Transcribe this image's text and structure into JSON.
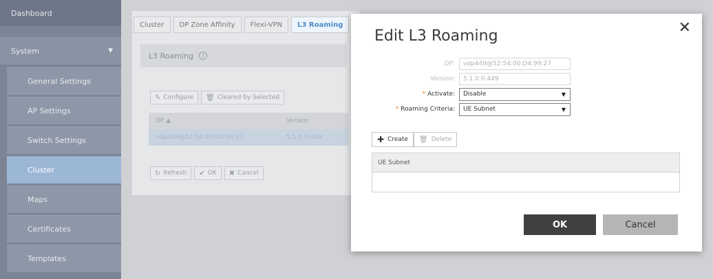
{
  "sidebar": {
    "dashboard": "Dashboard",
    "system": "System",
    "items": [
      {
        "label": "General Settings"
      },
      {
        "label": "AP Settings"
      },
      {
        "label": "Switch Settings"
      },
      {
        "label": "Cluster"
      },
      {
        "label": "Maps"
      },
      {
        "label": "Certificates"
      },
      {
        "label": "Templates"
      }
    ],
    "active_item": "Cluster"
  },
  "tabs": [
    {
      "label": "Cluster"
    },
    {
      "label": "DP Zone Affinity"
    },
    {
      "label": "Flexi-VPN"
    },
    {
      "label": "L3 Roaming"
    }
  ],
  "panel": {
    "title": "L3 Roaming",
    "help": "?",
    "configure_label": "Configure",
    "cleared_label": "Cleared by Selected",
    "columns": {
      "dp": "DP",
      "sort_indicator": "▲",
      "version": "Version"
    },
    "row": {
      "dp": "vdp449@52:54:00:D4:99:27",
      "version": "5.1.0.0.449"
    },
    "refresh_label": "Refresh",
    "ok_label": "OK",
    "cancel_label": "Cancel"
  },
  "modal": {
    "title": "Edit L3 Roaming",
    "close_icon": "✕",
    "dp_label": "DP:",
    "dp_value": "vdp449@52:54:00:D4:99:27",
    "version_label": "Version:",
    "version_value": "5.1.0.0.449",
    "required_marker": "*",
    "activate_label": "Activate:",
    "activate_value": "Disable",
    "criteria_label": "Roaming Criteria:",
    "criteria_value": "UE Subnet",
    "create_label": "Create",
    "delete_label": "Delete",
    "table_header": "UE Subnet",
    "ok_label": "OK",
    "cancel_label": "Cancel"
  },
  "colors": {
    "accent": "#4a8cc9",
    "required": "#e68a2e",
    "ok_button": "#404040",
    "cancel_button": "#b5b5b5"
  }
}
